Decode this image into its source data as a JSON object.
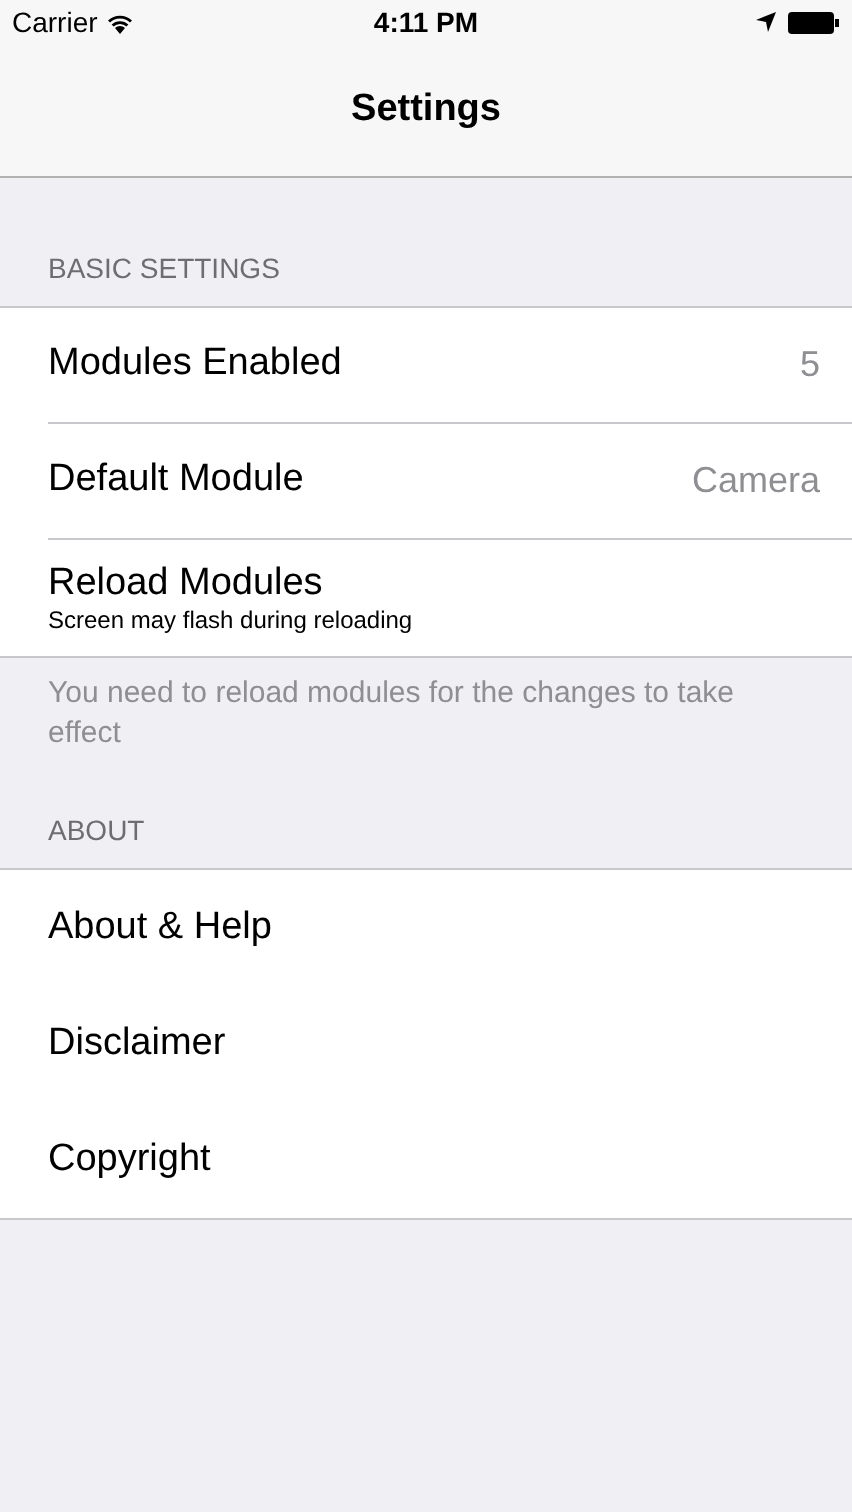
{
  "status_bar": {
    "carrier": "Carrier",
    "time": "4:11 PM"
  },
  "nav": {
    "title": "Settings"
  },
  "sections": [
    {
      "header": "BASIC SETTINGS",
      "separators": true,
      "rows": [
        {
          "kind": "value",
          "label": "Modules Enabled",
          "value": "5"
        },
        {
          "kind": "value",
          "label": "Default Module",
          "value": "Camera"
        },
        {
          "kind": "subtitle",
          "label": "Reload Modules",
          "subtitle": "Screen may flash during reloading"
        }
      ],
      "footer": "You need to reload modules for the changes to take effect"
    },
    {
      "header": "ABOUT",
      "separators": false,
      "rows": [
        {
          "kind": "plain",
          "label": "About & Help"
        },
        {
          "kind": "plain",
          "label": "Disclaimer"
        },
        {
          "kind": "plain",
          "label": "Copyright"
        }
      ]
    }
  ]
}
